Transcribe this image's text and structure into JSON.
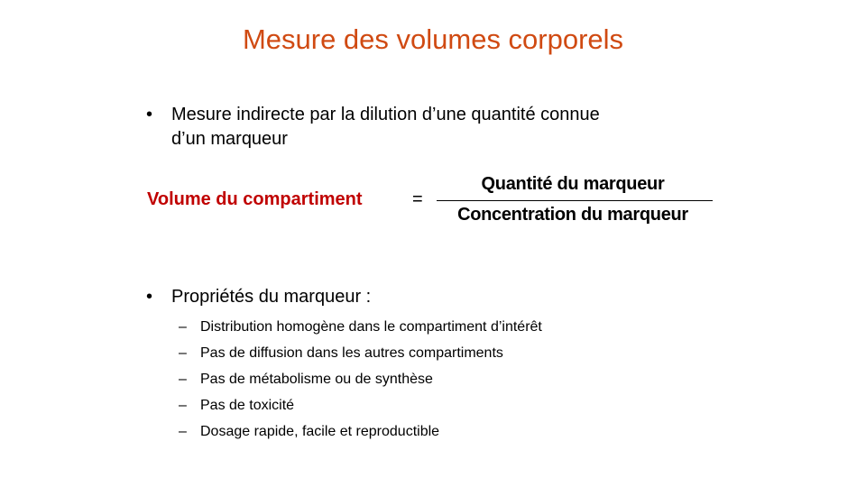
{
  "slide": {
    "title": "Mesure des volumes corporels",
    "bullet1": {
      "marker": "•",
      "line1": "Mesure indirecte par la dilution d’une quantité connue",
      "line2": "d’un marqueur"
    },
    "equation": {
      "lhs": "Volume du compartiment",
      "sign": "=",
      "numerator": "Quantité du marqueur",
      "denominator": "Concentration du marqueur"
    },
    "bullet2": {
      "marker": "•",
      "text": "Propriétés du marqueur :",
      "dash": "–",
      "items": [
        "Distribution homogène dans le compartiment d’intérêt",
        "Pas de diffusion dans les autres compartiments",
        "Pas de métabolisme ou de synthèse",
        "Pas de toxicité",
        "Dosage rapide, facile et reproductible"
      ]
    },
    "colors": {
      "title": "#d04a12",
      "equation_lhs": "#c00000"
    }
  }
}
